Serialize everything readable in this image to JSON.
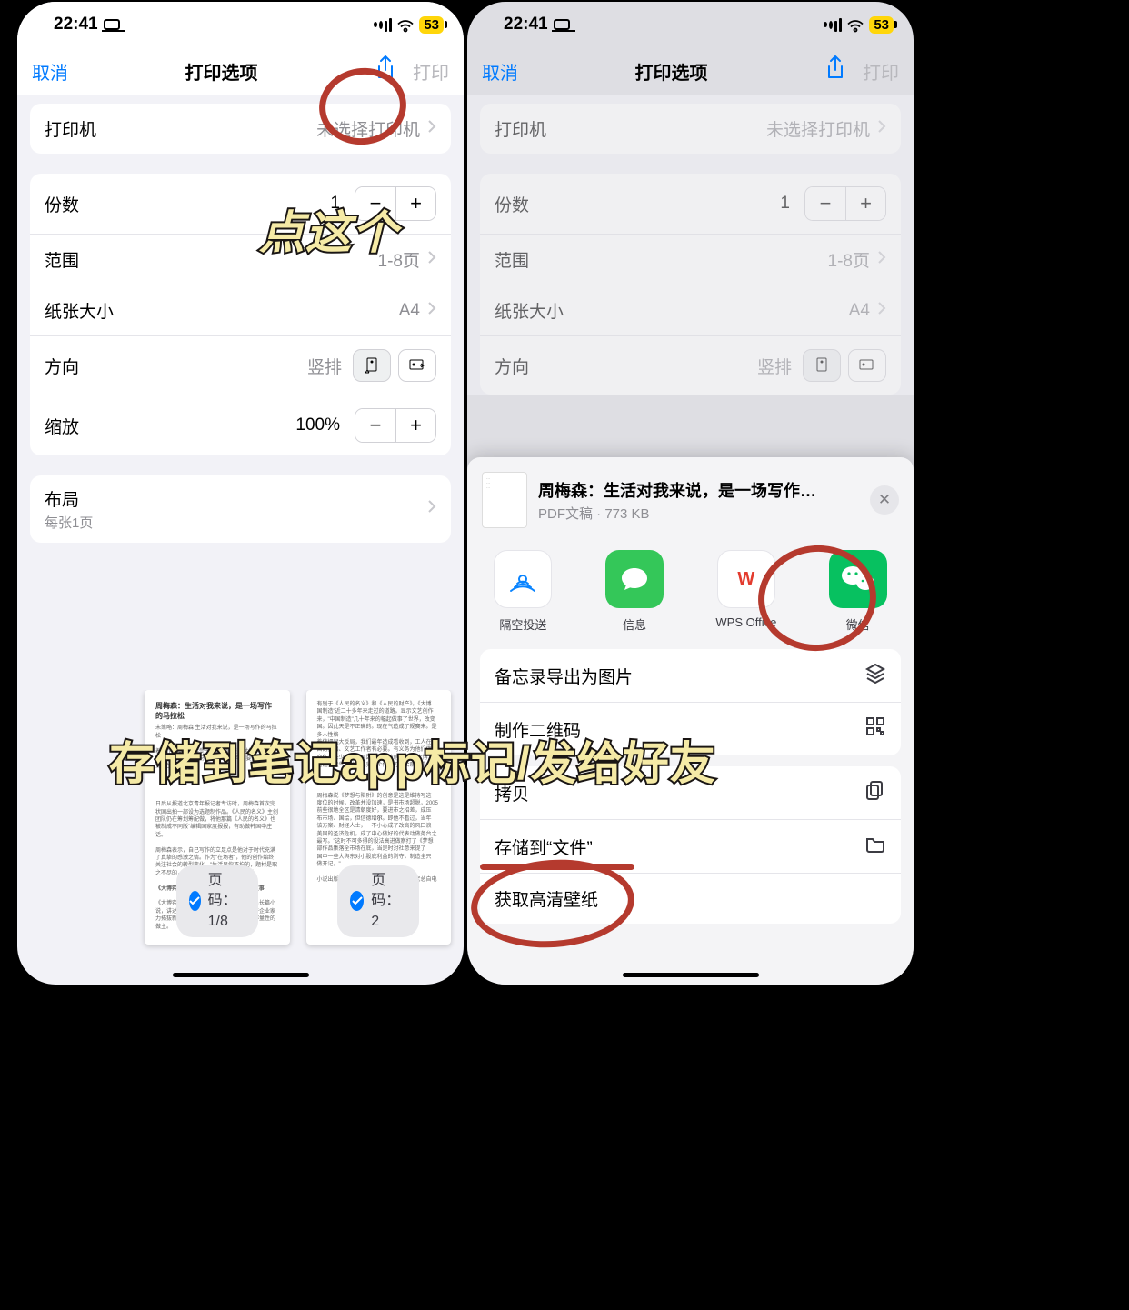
{
  "status": {
    "time": "22:41",
    "battery": "53"
  },
  "nav": {
    "cancel": "取消",
    "title": "打印选项",
    "print": "打印"
  },
  "rows": {
    "printer_label": "打印机",
    "printer_value": "未选择打印机",
    "copies_label": "份数",
    "copies_value": "1",
    "range_label": "范围",
    "range_value": "1-8页",
    "paper_label": "纸张大小",
    "paper_value": "A4",
    "orient_label": "方向",
    "orient_value": "竖排",
    "scale_label": "缩放",
    "scale_value": "100%",
    "layout_label": "布局",
    "layout_sub": "每张1页"
  },
  "thumbs": {
    "title": "周梅森：生活对我来说，是一场写作的马拉松",
    "page_prefix": "页码：",
    "page1": "1/8",
    "page2": "2"
  },
  "share_sheet": {
    "title": "周梅森：生活对我来说，是一场写作…",
    "subtitle": "PDF文稿 · 773 KB",
    "apps": {
      "airdrop": "隔空投送",
      "messages": "信息",
      "wps": "WPS Office",
      "wechat": "微信"
    },
    "actions": {
      "memo_export": "备忘录导出为图片",
      "qrcode": "制作二维码",
      "copy": "拷贝",
      "save_files": "存储到“文件”",
      "wallpaper": "获取高清壁纸"
    }
  },
  "annotation": {
    "tap_this": "点这个",
    "banner": "存储到笔记app标记/发给好友"
  }
}
